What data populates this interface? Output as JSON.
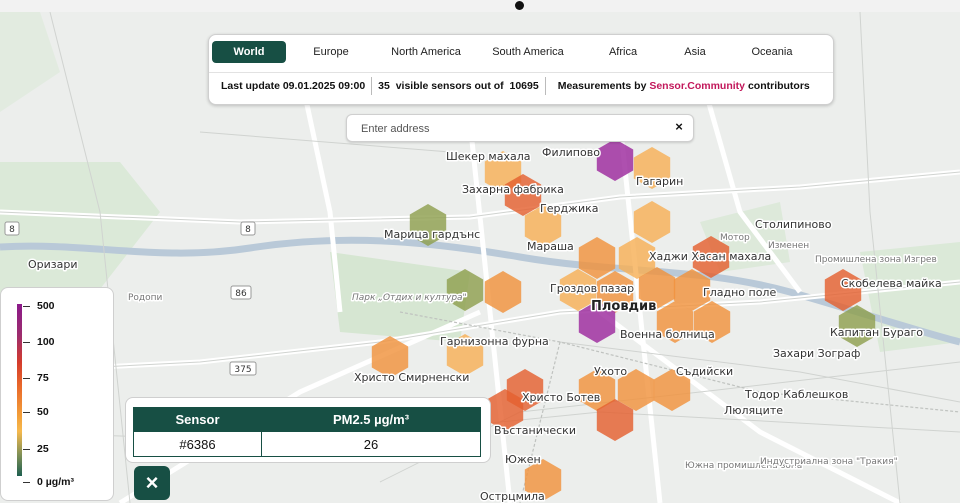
{
  "regions": [
    "World",
    "Europe",
    "North America",
    "South America",
    "Africa",
    "Asia",
    "Oceania"
  ],
  "active_region": "World",
  "info": {
    "last_update": "Last update 09.01.2025 09:00",
    "visible_count": "35",
    "visible_mid": "visible sensors out of",
    "total_count": "10695",
    "measurements_prefix": "Measurements by",
    "brand": "Sensor.Community",
    "measurements_suffix": "contributors"
  },
  "search": {
    "placeholder": "Enter address",
    "clear_label": "×"
  },
  "legend": {
    "stops": [
      {
        "label": "500",
        "value": 500
      },
      {
        "label": "100",
        "value": 100
      },
      {
        "label": "75",
        "value": 75
      },
      {
        "label": "50",
        "value": 50
      },
      {
        "label": "25",
        "value": 25
      },
      {
        "label": "0 µg/m³",
        "value": 0
      }
    ]
  },
  "sensor_popup": {
    "col_sensor": "Sensor",
    "col_value": "PM2.5 µg/m³",
    "sensor_id": "#6386",
    "value": "26"
  },
  "close_label": "×",
  "colors": {
    "accent": "#174f44",
    "brand": "#c2185b",
    "hex_purple": "#9c2a9e",
    "hex_red": "#e4602f",
    "hex_orange": "#f0923d",
    "hex_lightorange": "#f6b057",
    "hex_olive": "#8fa04f"
  },
  "map": {
    "places": [
      "Шекер махала",
      "Филипово",
      "Гагарин",
      "Захарна фабрика",
      "Герджика",
      "Марица гардънс",
      "Мараша",
      "Хаджи Хасан махала",
      "Столипиново",
      "Изменен",
      "Оризари",
      "Гроздов пазар",
      "Пловдив",
      "Гладно поле",
      "Скобелева майка",
      "Военна болница",
      "Капитан Бураго",
      "Гарнизонна фурна",
      "Христо Смирненски",
      "Захари Зограф",
      "Ухото",
      "Съдийски",
      "Тодор Каблешков",
      "Христо Ботев",
      "Люляците",
      "Въстанически",
      "Южен",
      "Острцмила",
      "Южна промишлена зона",
      "Индустриална зона \"Тракия\"",
      "Родопи",
      "Мотор",
      "Парк „Отдих и култура\"",
      "Промишлена зона Изгрев"
    ],
    "roads": [
      "8",
      "86",
      "375",
      "8"
    ]
  }
}
